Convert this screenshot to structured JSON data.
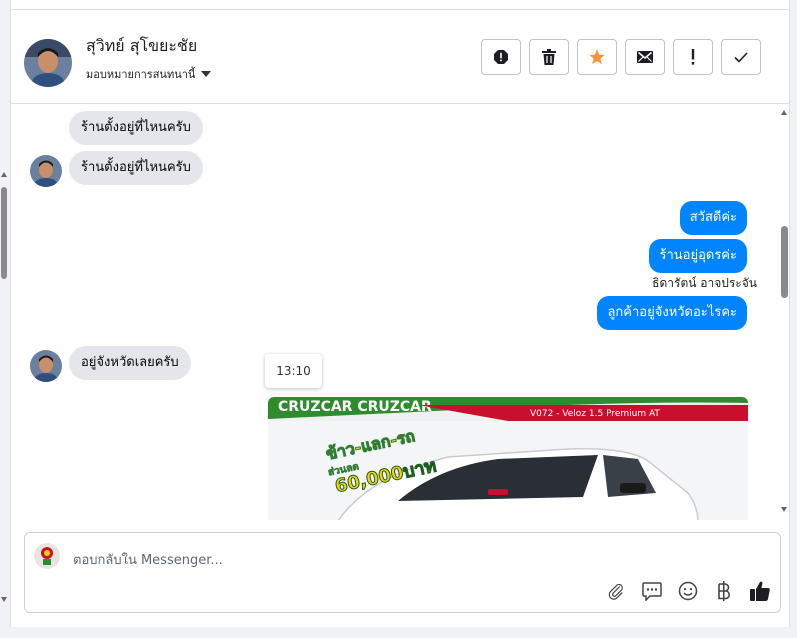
{
  "contact": {
    "name": "สุวิทย์ สุโขยะชัย",
    "assign_label": "มอบหมายการสนทนานี้"
  },
  "toolbar": {
    "spam_icon": "alert-circle-icon",
    "delete_icon": "trash-icon",
    "star_icon": "star-icon",
    "unread_icon": "envelope-icon",
    "follow_up_icon": "exclamation-icon",
    "done_icon": "checkmark-icon"
  },
  "messages": {
    "incoming": [
      {
        "text": "ร้านตั้งอยู่ที่ไหนครับ"
      },
      {
        "text": "ร้านตั้งอยู่ที่ไหนครับ"
      },
      {
        "text": "อยู่จังหวัดเลยครับ"
      }
    ],
    "outgoing": [
      {
        "text": "สวัสดีค่ะ"
      },
      {
        "text": "ร้านอยู่อุดรค่ะ"
      },
      {
        "text": "ลูกค้าอยู่จังหวัดอะไรคะ"
      }
    ],
    "sender_name": "ธิดารัตน์ อาจประจัน",
    "timestamp": "13:10"
  },
  "promo_image": {
    "header_text": "CRUZCAR CRUZCAR",
    "model_text": "V072 - Veloz 1.5 Premium AT",
    "headline": "ข้าว-แลก-รถ",
    "discount_label": "ส่วนลด",
    "discount_value": "60,000บาท"
  },
  "composer": {
    "placeholder": "ตอบกลับใน Messenger...",
    "icons": [
      "attachment-icon",
      "saved-reply-icon",
      "emoji-icon",
      "baht-icon",
      "thumbs-up-icon"
    ]
  },
  "colors": {
    "outgoing_bubble": "#0084ff",
    "incoming_bubble": "#e4e6eb",
    "star": "#f7923b",
    "promo_red": "#c8102e",
    "promo_green": "#2e8b2e"
  }
}
